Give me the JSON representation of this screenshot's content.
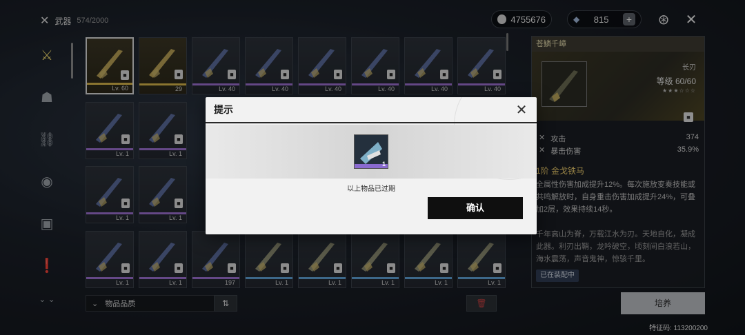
{
  "topbar": {
    "category_label": "武器",
    "count": "574/2000",
    "coins": "4755676",
    "stamina": "815",
    "plus": "+"
  },
  "nav": [
    "weapon",
    "companion",
    "material",
    "gift",
    "chip",
    "quest"
  ],
  "grid": {
    "rows": [
      [
        {
          "level": "Lv. 60",
          "rarity": "gold",
          "selected": true
        },
        {
          "level": "29",
          "rarity": "gold"
        },
        {
          "level": "Lv. 40",
          "rarity": "purple"
        },
        {
          "level": "Lv. 40",
          "rarity": "purple"
        },
        {
          "level": "Lv. 40",
          "rarity": "purple"
        },
        {
          "level": "Lv. 40",
          "rarity": "purple"
        },
        {
          "level": "Lv. 40",
          "rarity": "purple"
        },
        {
          "level": "Lv. 40",
          "rarity": "purple"
        }
      ],
      [
        {
          "level": "Lv. 1",
          "rarity": "purple"
        },
        {
          "level": "Lv. 1",
          "rarity": "purple"
        }
      ],
      [
        {
          "level": "Lv. 1",
          "rarity": "purple"
        },
        {
          "level": "Lv. 1",
          "rarity": "purple"
        }
      ],
      [
        {
          "level": "Lv. 1",
          "rarity": "purple"
        },
        {
          "level": "Lv. 1",
          "rarity": "purple"
        },
        {
          "level": "197",
          "rarity": "purple"
        },
        {
          "level": "Lv. 1",
          "rarity": "blue"
        },
        {
          "level": "Lv. 1",
          "rarity": "blue"
        },
        {
          "level": "Lv. 1",
          "rarity": "blue"
        },
        {
          "level": "Lv. 1",
          "rarity": "blue"
        },
        {
          "level": "Lv. 1",
          "rarity": "blue"
        }
      ]
    ]
  },
  "filter": {
    "label": "物品品质",
    "sort_icon": "⇅"
  },
  "detail": {
    "name": "苍鳞千嶂",
    "type": "长刃",
    "level_label": "等级 60/60",
    "stars": "★★★☆☆☆",
    "stats": [
      {
        "name": "攻击",
        "value": "374"
      },
      {
        "name": "暴击伤害",
        "value": "35.9%"
      }
    ],
    "passive_title": "1阶 金戈铁马",
    "passive_desc": "全属性伤害加成提升12%。每次施放变奏技能或共鸣解放时，自身重击伤害加成提升24%，可叠加2层，效果持续14秒。",
    "lore": "千年高山为脊，万载江水为刃。天地自化，凝成此器。利刃出鞘，龙吟破空，顷刻间白浪若山，海水震荡，声音鬼神，惊骇千里。",
    "equipped": "已在装配中"
  },
  "train_button": "培养",
  "feature_code": "特征码: 113200200",
  "dialog": {
    "title": "提示",
    "item_qty": "1",
    "message": "以上物品已过期",
    "confirm": "确认"
  }
}
